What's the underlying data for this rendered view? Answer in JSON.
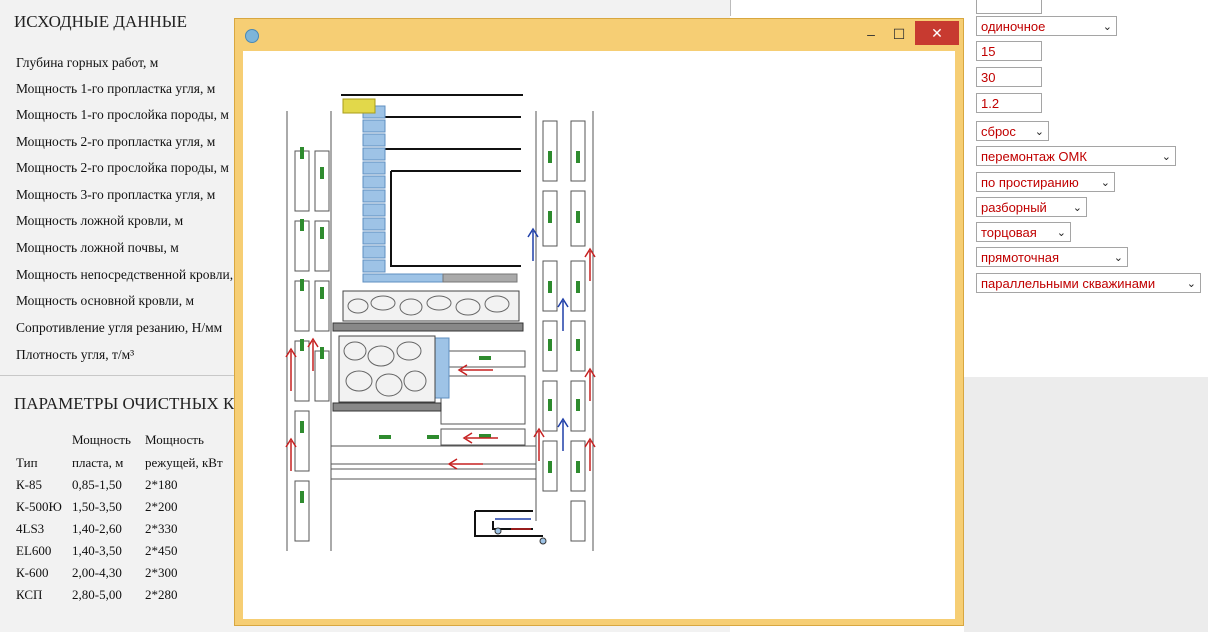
{
  "input_panel": {
    "title": "ИСХОДНЫЕ ДАННЫЕ",
    "fields": [
      {
        "label": "Глубина горных работ, м"
      },
      {
        "label": "Мощность 1-го пропластка угля, м"
      },
      {
        "label": "Мощность 1-го прослойка породы, м"
      },
      {
        "label": "Мощность 2-го пропластка угля, м"
      },
      {
        "label": "Мощность 2-го прослойка породы, м"
      },
      {
        "label": "Мощность 3-го пропластка угля, м"
      },
      {
        "label": "Мощность ложной кровли, м"
      },
      {
        "label": "Мощность ложной почвы, м"
      },
      {
        "label": "Мощность непосредственной кровли, м"
      },
      {
        "label": "Мощность основной кровли, м"
      },
      {
        "label": "Сопротивление угля резанию, Н/мм"
      },
      {
        "label": "Плотность угля, т/м³"
      }
    ]
  },
  "params_panel": {
    "title": "ПАРАМЕТРЫ ОЧИСТНЫХ КОМБАЙНОВ",
    "header_row1": [
      "",
      "Мощность",
      "Мощность"
    ],
    "header_row2": [
      "Тип",
      "пласта, м",
      "режущей, кВт"
    ],
    "rows": [
      [
        "К-85",
        "0,85-1,50",
        "2*180"
      ],
      [
        "К-500Ю",
        "1,50-3,50",
        "2*200"
      ],
      [
        "4LS3",
        "1,40-2,60",
        "2*330"
      ],
      [
        "EL600",
        "1,40-3,50",
        "2*450"
      ],
      [
        "К-600",
        "2,00-4,30",
        "2*300"
      ],
      [
        "КСП",
        "2,80-5,00",
        "2*280"
      ]
    ]
  },
  "right_controls": {
    "blank_field": "",
    "select_1": "одиночное",
    "input_1": "15",
    "input_2": "30",
    "input_3": "1.2",
    "select_2": "сброс",
    "select_3": "перемонтаж ОМК",
    "select_4": "по простиранию",
    "select_5": "разборный",
    "select_6": "торцовая",
    "select_7": "прямоточная",
    "select_8": "параллельными скважинами"
  },
  "popup": {
    "min_glyph": "–",
    "max_glyph": "☐",
    "close_glyph": "✕"
  },
  "colors": {
    "select_text": "#c00000",
    "window_frame": "#f6ce74",
    "close_button": "#c73a30",
    "green_marker": "#2e8b2e",
    "blue_arrow": "#1f3fa8",
    "red_arrow": "#c62020",
    "longwall_blue": "#9ec3e6"
  },
  "icons": {
    "window": "globe-icon",
    "minimize": "minimize-icon",
    "maximize": "maximize-icon",
    "close": "close-icon",
    "dropdown": "chevron-down-icon"
  }
}
